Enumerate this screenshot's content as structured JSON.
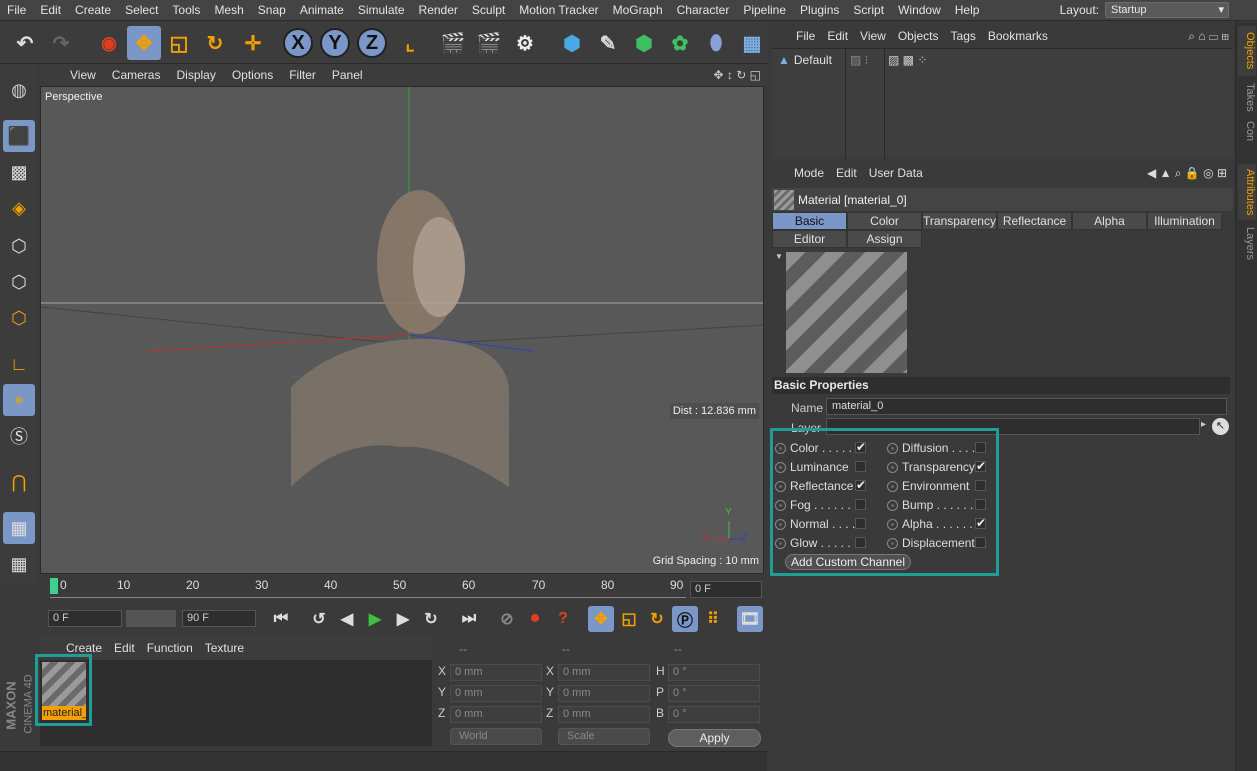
{
  "menubar": {
    "items": [
      "File",
      "Edit",
      "Create",
      "Select",
      "Tools",
      "Mesh",
      "Snap",
      "Animate",
      "Simulate",
      "Render",
      "Sculpt",
      "Motion Tracker",
      "MoGraph",
      "Character",
      "Pipeline",
      "Plugins",
      "Script",
      "Window",
      "Help"
    ],
    "layout_label": "Layout:",
    "layout_value": "Startup"
  },
  "toolbar": {
    "axis_x": "X",
    "axis_y": "Y",
    "axis_z": "Z"
  },
  "viewport": {
    "menu": [
      "View",
      "Cameras",
      "Display",
      "Options",
      "Filter",
      "Panel"
    ],
    "name": "Perspective",
    "dist": "Dist : 12.836 mm",
    "grid_spacing": "Grid Spacing : 10 mm",
    "axis_y": "Y",
    "axis_x": "X",
    "axis_z": "Z"
  },
  "timeline": {
    "ticks": [
      "0",
      "10",
      "20",
      "30",
      "40",
      "50",
      "60",
      "70",
      "80",
      "90"
    ],
    "current_frame": "0 F",
    "start_field": "0 F",
    "end_field": "90 F"
  },
  "material_manager": {
    "menu": [
      "Create",
      "Edit",
      "Function",
      "Texture"
    ],
    "material_name": "material_"
  },
  "coordinates": {
    "headers": [
      "--",
      "--",
      "--"
    ],
    "rows": [
      {
        "l1": "X",
        "v1": "0 mm",
        "l2": "X",
        "v2": "0 mm",
        "l3": "H",
        "v3": "0 °"
      },
      {
        "l1": "Y",
        "v1": "0 mm",
        "l2": "Y",
        "v2": "0 mm",
        "l3": "P",
        "v3": "0 °"
      },
      {
        "l1": "Z",
        "v1": "0 mm",
        "l2": "Z",
        "v2": "0 mm",
        "l3": "B",
        "v3": "0 °"
      }
    ],
    "world": "World",
    "scale": "Scale",
    "apply": "Apply"
  },
  "brand": {
    "line1": "MAXON",
    "line2": "CINEMA 4D"
  },
  "object_manager": {
    "menu": [
      "File",
      "Edit",
      "View",
      "Objects",
      "Tags",
      "Bookmarks"
    ],
    "object_name": "Default"
  },
  "attributes": {
    "menu": [
      "Mode",
      "Edit",
      "User Data"
    ],
    "title": "Material [material_0]",
    "tabs_row1": [
      "Basic",
      "Color",
      "Transparency",
      "Reflectance",
      "Alpha",
      "Illumination"
    ],
    "tabs_row2": [
      "Editor",
      "Assign"
    ],
    "section": "Basic Properties",
    "name_label": "Name",
    "name_value": "material_0",
    "layer_label": "Layer",
    "channels_left": [
      {
        "label": "Color . . . . . .",
        "checked": true
      },
      {
        "label": "Luminance",
        "checked": false
      },
      {
        "label": "Reflectance",
        "checked": true
      },
      {
        "label": "Fog . . . . . . .",
        "checked": false
      },
      {
        "label": "Normal . . . .",
        "checked": false
      },
      {
        "label": "Glow . . . . . .",
        "checked": false
      }
    ],
    "channels_right": [
      {
        "label": "Diffusion . . . .",
        "checked": false
      },
      {
        "label": "Transparency",
        "checked": true
      },
      {
        "label": "Environment",
        "checked": false
      },
      {
        "label": "Bump . . . . . .",
        "checked": false
      },
      {
        "label": "Alpha . . . . . .",
        "checked": true
      },
      {
        "label": "Displacement",
        "checked": false
      }
    ],
    "add_channel": "Add Custom Channel"
  },
  "side_tabs": [
    "Objects",
    "Takes",
    "Con",
    "Attributes",
    "Layers"
  ]
}
